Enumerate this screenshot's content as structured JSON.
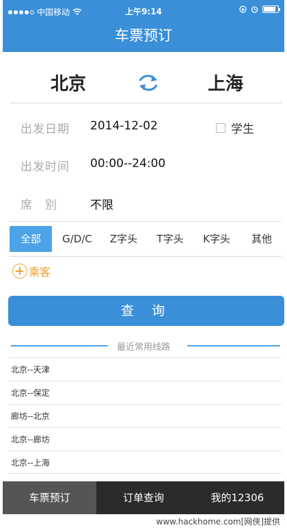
{
  "status_bar": {
    "carrier": "中国移动",
    "time": "上午9:14"
  },
  "header": {
    "title": "车票预订"
  },
  "route": {
    "from_city": "北京",
    "to_city": "上海",
    "swap_icon": "swap-arrows-icon"
  },
  "form": {
    "date_label": "出发日期",
    "date_value": "2014-12-02",
    "student_label": "学生",
    "student_checked": false,
    "time_label": "出发时间",
    "time_value": "00:00--24:00",
    "seat_label": "席　别",
    "seat_value": "不限"
  },
  "filters": [
    "全部",
    "G/D/C",
    "Z字头",
    "T字头",
    "K字头",
    "其他"
  ],
  "passenger": {
    "label": "乘客"
  },
  "query_button": {
    "label": "查 询"
  },
  "recent": {
    "title": "最近常用线路",
    "routes": [
      "北京--天津",
      "北京--保定",
      "廊坊--北京",
      "北京--廊坊",
      "北京--上海"
    ]
  },
  "tabbar": {
    "tabs": [
      "车票预订",
      "订单查询",
      "我的12306"
    ]
  },
  "watermark": "www.hackhome.com[网侠]提供",
  "colors": {
    "accent": "#3a8fd8",
    "passenger": "#f0a030",
    "tabbar": "#2b2b2b"
  }
}
